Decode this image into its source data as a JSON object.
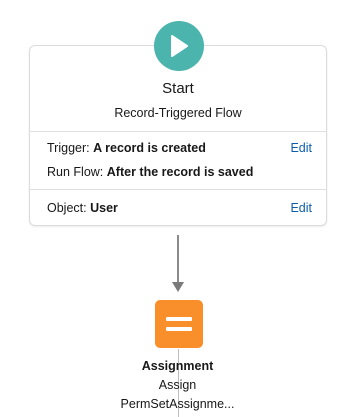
{
  "start_node": {
    "title": "Start",
    "subtitle": "Record-Triggered Flow",
    "trigger_label": "Trigger:",
    "trigger_value": "A record is created",
    "run_flow_label": "Run Flow:",
    "run_flow_value": "After the record is saved",
    "object_label": "Object:",
    "object_value": "User",
    "edit_label_1": "Edit",
    "edit_label_2": "Edit",
    "icon": "play-icon",
    "icon_color": "#4bb4ad"
  },
  "assignment_node": {
    "type_label": "Assignment",
    "name_line1": "Assign",
    "name_line2": "PermSetAssignme...",
    "icon": "assignment-equals-icon",
    "icon_color": "#f88f2a"
  },
  "colors": {
    "link": "#0b5cab",
    "connector": "#8a8a8a"
  }
}
